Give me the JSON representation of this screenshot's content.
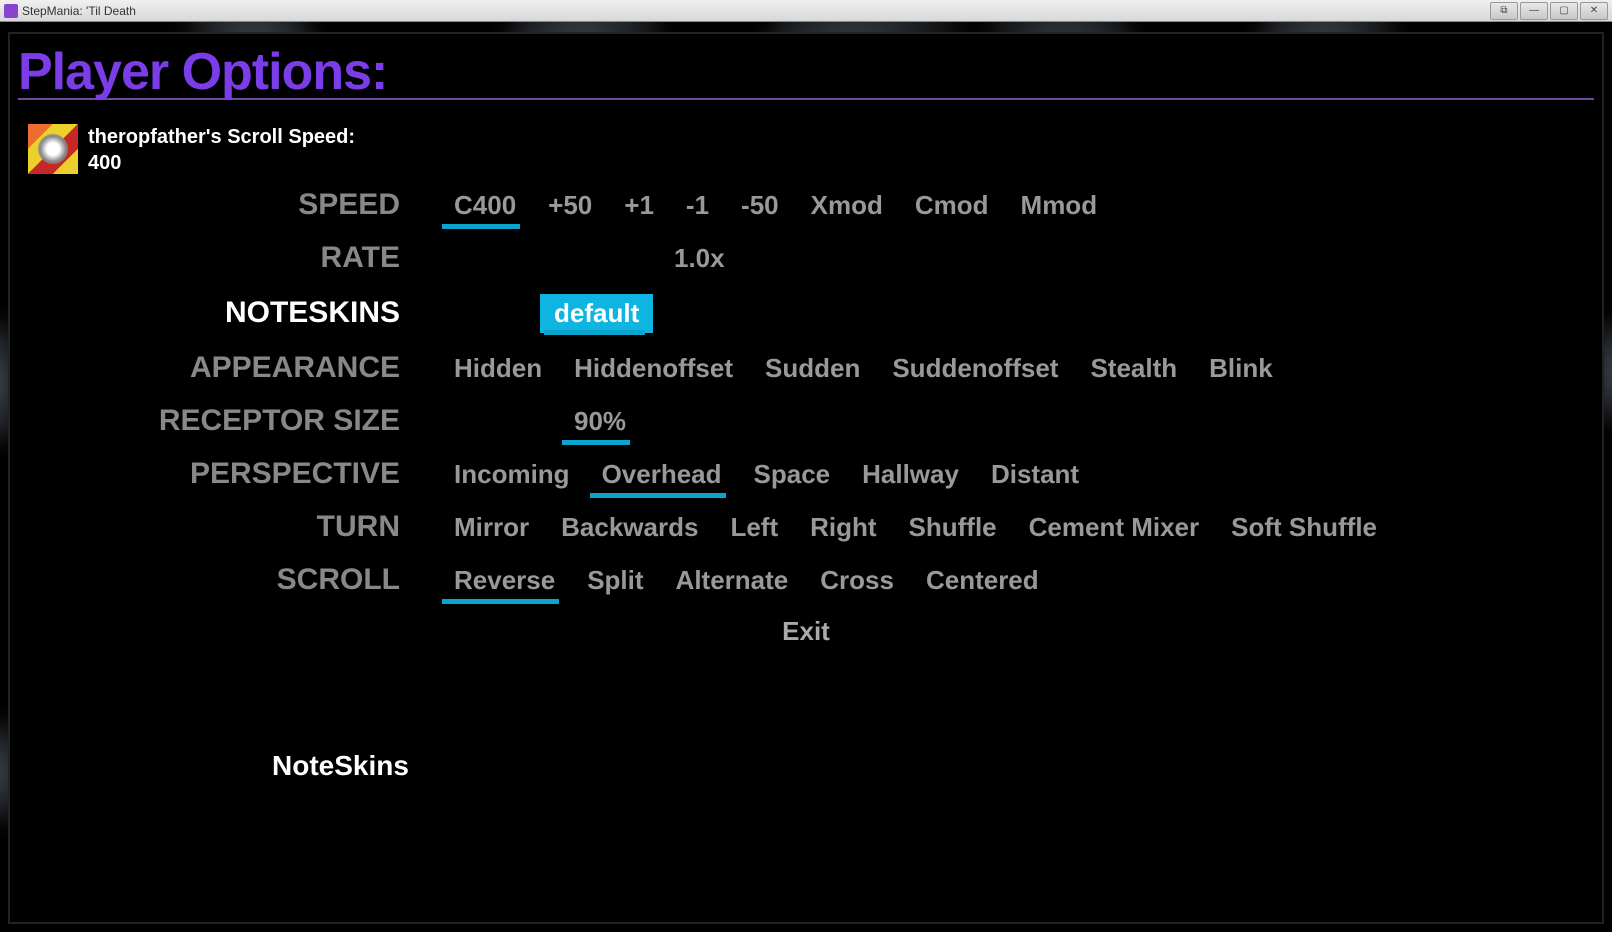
{
  "window": {
    "title": "StepMania: 'Til Death"
  },
  "header": {
    "title": "Player Options:"
  },
  "player": {
    "scroll_speed_label": "theropfather's Scroll Speed:",
    "scroll_speed_value": "400"
  },
  "options": {
    "speed": {
      "label": "SPEED",
      "values": [
        "C400",
        "+50",
        "+1",
        "-1",
        "-50",
        "Xmod",
        "Cmod",
        "Mmod"
      ],
      "selected_index": 0
    },
    "rate": {
      "label": "RATE",
      "value": "1.0x"
    },
    "noteskins": {
      "label": "NOTESKINS",
      "values": [
        "default"
      ],
      "selected_index": 0
    },
    "appearance": {
      "label": "APPEARANCE",
      "values": [
        "Hidden",
        "Hiddenoffset",
        "Sudden",
        "Suddenoffset",
        "Stealth",
        "Blink"
      ]
    },
    "receptor_size": {
      "label": "RECEPTOR SIZE",
      "value": "90%"
    },
    "perspective": {
      "label": "PERSPECTIVE",
      "values": [
        "Incoming",
        "Overhead",
        "Space",
        "Hallway",
        "Distant"
      ],
      "selected_index": 1
    },
    "turn": {
      "label": "TURN",
      "values": [
        "Mirror",
        "Backwards",
        "Left",
        "Right",
        "Shuffle",
        "Cement Mixer",
        "Soft Shuffle"
      ]
    },
    "scroll": {
      "label": "SCROLL",
      "values": [
        "Reverse",
        "Split",
        "Alternate",
        "Cross",
        "Centered"
      ],
      "selected_index": 0
    },
    "exit": {
      "label": "Exit"
    }
  },
  "footer": {
    "current_option": "NoteSkins"
  },
  "active_row": "noteskins"
}
